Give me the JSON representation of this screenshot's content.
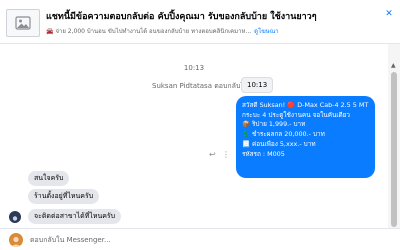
{
  "ad": {
    "title": "แชทนี้มีข้อความตอบกลับต่อ คับปิ้งคุณมา รับของกลับบ้าย ใช้งานยาวๆ",
    "subtitle": "จ่าย 2,000 บ้านอน ขับไปทำงานได้ อนของกลับบ้าย ทางตอบคลินิกเคมาห...",
    "link_label": "ดูโฆษณา",
    "car_icon": "car-icon",
    "thumb_icon": "image-icon",
    "close_icon": "close-icon"
  },
  "conversation": {
    "timestamp": "10:13",
    "replied_label": "Suksan Pidtatasa ตอบกลับโฆษณา",
    "tooltip_time": "10:13",
    "outgoing_message": {
      "lines": [
        "สวัสดี Suksan! 🔴 D-Max Cab-4 2.5 5 MT",
        "กระบะ 4 ประตูใช้งานคน จอในคันเดียว",
        "📦 ริปาย 1,999.- บาท",
        "💲 ชำระผลกล 20,000.- บาท",
        "📃 ค่อนเพื่อง 5,xxx.- บาท",
        "รหัสรถ : M005"
      ]
    },
    "incoming_messages": [
      "สนใจครับ",
      "ร้านตั้งอยู่ที่ไหนครับ",
      "จะติดต่อสาขาได้ที่ไหนครับ"
    ],
    "reply_icon": "reply-icon",
    "more_icon": "more-options-icon"
  },
  "composer": {
    "placeholder": "ตอบกลับใน Messenger..."
  },
  "colors": {
    "outgoing_bubble": "#0a7cff",
    "incoming_bubble": "#e4e6eb",
    "link": "#0a7cff"
  }
}
